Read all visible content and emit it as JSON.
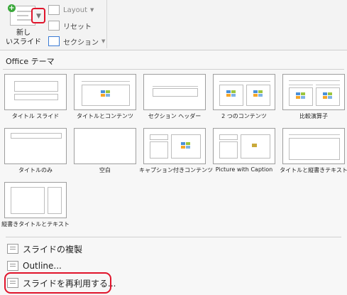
{
  "ribbon": {
    "new_slide_label_line1": "新し",
    "new_slide_label_line2": "いスライド",
    "layout_label": "Layout",
    "reset_label": "リセット",
    "section_label": "セクション"
  },
  "panel": {
    "theme_header": "Office テーマ",
    "layouts": [
      {
        "label": "タイトル スライド"
      },
      {
        "label": "タイトルとコンテンツ"
      },
      {
        "label": "セクション ヘッダー"
      },
      {
        "label": "2 つのコンテンツ"
      },
      {
        "label": "比較演算子"
      },
      {
        "label": "タイトルのみ"
      },
      {
        "label": "空白"
      },
      {
        "label": "キャプション付きコンテンツ"
      },
      {
        "label": "Picture with Caption"
      },
      {
        "label": "タイトルと縦書きテキスト"
      },
      {
        "label": "縦書きタイトルとテキスト"
      }
    ]
  },
  "menu": {
    "duplicate": "スライドの複製",
    "outline": "Outline...",
    "reuse": "スライドを再利用する..."
  },
  "colors": {
    "highlight_ring": "#e0142b",
    "accent_green": "#3aa83a"
  }
}
